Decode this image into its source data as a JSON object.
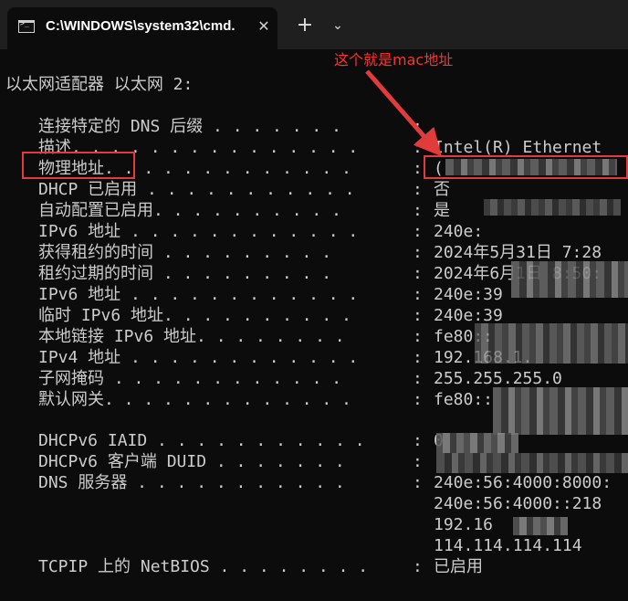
{
  "window": {
    "tab_title": "C:\\WINDOWS\\system32\\cmd.",
    "close_glyph": "✕",
    "new_tab_glyph": "+",
    "dropdown_glyph": "⌄"
  },
  "terminal": {
    "adapter_header": "以太网适配器 以太网 2:",
    "rows": [
      {
        "label": "连接特定的 DNS 后缀 . . . . . . .",
        "colon": ":",
        "value": ""
      },
      {
        "label": "描述. . . . . . . . . . . . . . .",
        "colon": ":",
        "value": "Intel(R) Ethernet"
      },
      {
        "label": "物理地址. . . . . . . . . . . . .",
        "colon": ":",
        "value": "("
      },
      {
        "label": "DHCP 已启用 . . . . . . . . . . .",
        "colon": ":",
        "value": "否"
      },
      {
        "label": "自动配置已启用. . . . . . . . . .",
        "colon": ":",
        "value": "是"
      },
      {
        "label": "IPv6 地址 . . . . . . . . . . . .",
        "colon": ":",
        "value": "240e:"
      },
      {
        "label": "获得租约的时间 . . . . . . . . .",
        "colon": ":",
        "value": "2024年5月31日 7:28"
      },
      {
        "label": "租约过期的时间 . . . . . . . . .",
        "colon": ":",
        "value": "2024年6月1日 8:50:"
      },
      {
        "label": "IPv6 地址 . . . . . . . . . . . .",
        "colon": ":",
        "value": "240e:39"
      },
      {
        "label": "临时 IPv6 地址. . . . . . . . . .",
        "colon": ":",
        "value": "240e:39"
      },
      {
        "label": "本地链接 IPv6 地址. . . . . . . .",
        "colon": ":",
        "value": "fe80::"
      },
      {
        "label": "IPv4 地址 . . . . . . . . . . . .",
        "colon": ":",
        "value": "192.168.1."
      },
      {
        "label": "子网掩码 . . . . . . . . . . . .",
        "colon": ":",
        "value": "255.255.255.0"
      },
      {
        "label": "默认网关. . . . . . . . . . . . .",
        "colon": ":",
        "value": "fe80::"
      }
    ],
    "rows2": [
      {
        "label": "DHCPv6 IAID . . . . . . . . . . .",
        "colon": ":",
        "value": "0"
      },
      {
        "label": "DHCPv6 客户端 DUID . . . . . . .",
        "colon": ":",
        "value": ""
      },
      {
        "label": "DNS 服务器 . . . . . . . . . . .",
        "colon": ":",
        "value": "240e:56:4000:8000:"
      }
    ],
    "dns_extra": [
      "240e:56:4000::218",
      "192.16",
      "114.114.114.114"
    ],
    "netbios": {
      "label": "TCPIP 上的 NetBIOS . . . . . . . .",
      "colon": ":",
      "value": "已启用"
    }
  },
  "annotation": {
    "text": "这个就是mac地址",
    "color": "#e23b3b"
  }
}
